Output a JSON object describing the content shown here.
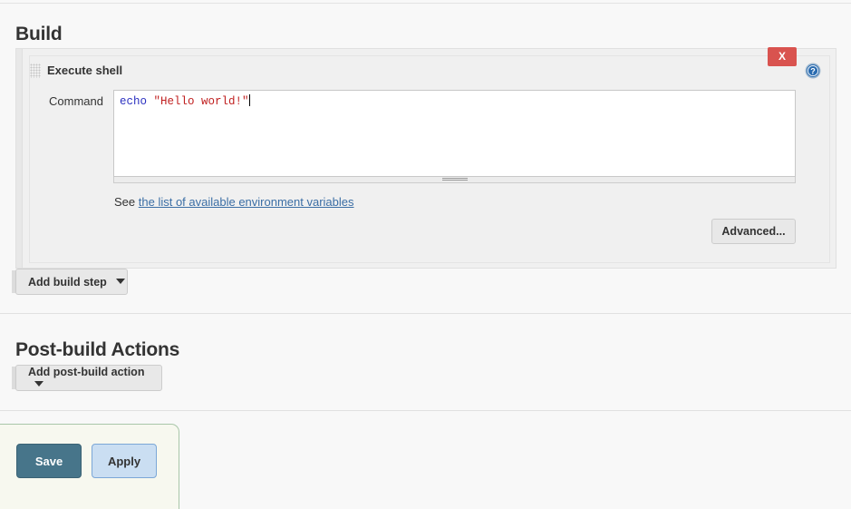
{
  "sections": {
    "build": {
      "heading": "Build",
      "add_step_label": "Add build step"
    },
    "post_build": {
      "heading": "Post-build Actions",
      "add_action_label": "Add post-build action"
    }
  },
  "build_step": {
    "title": "Execute shell",
    "delete_label": "X",
    "help_label": "?",
    "command_label": "Command",
    "command_value": "echo \"Hello world!\"",
    "command_tokens": {
      "command": "echo",
      "string": "\"Hello world!\""
    },
    "env_note_prefix": "See",
    "env_note_link": "the list of available environment variables",
    "advanced_label": "Advanced..."
  },
  "form_actions": {
    "save_label": "Save",
    "apply_label": "Apply"
  },
  "colors": {
    "delete_red": "#d9534f",
    "save_teal": "#47758a",
    "apply_blue": "#cadef2",
    "link_blue": "#3b6ea5",
    "code_command": "#2b30c0",
    "code_string": "#c02020",
    "save_bar_border": "#a9c7a9"
  },
  "icons": {
    "drag_handle": "drag-handle-icon",
    "help": "help-icon",
    "chevron_down": "chevron-down-icon",
    "resize_grip": "resize-grip-icon"
  }
}
